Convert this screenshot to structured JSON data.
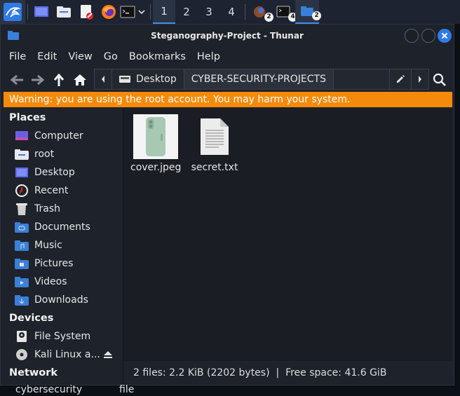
{
  "taskbar": {
    "workspaces": [
      "1",
      "2",
      "3",
      "4"
    ],
    "badges": {
      "app1": "2",
      "terminal": "4",
      "files": "2"
    }
  },
  "window": {
    "title": "Steganography-Project - Thunar",
    "menus": [
      "File",
      "Edit",
      "View",
      "Go",
      "Bookmarks",
      "Help"
    ],
    "breadcrumbs": [
      "Desktop",
      "CYBER-SECURITY-PROJECTS"
    ],
    "warning": "Warning: you are using the root account. You may harm your system."
  },
  "sidebar": {
    "places_heading": "Places",
    "places": [
      "Computer",
      "root",
      "Desktop",
      "Recent",
      "Trash",
      "Documents",
      "Music",
      "Pictures",
      "Videos",
      "Downloads"
    ],
    "devices_heading": "Devices",
    "devices": [
      "File System",
      "Kali Linux a..."
    ],
    "network_heading": "Network"
  },
  "files": [
    {
      "name": "cover.jpeg",
      "icon": "image-thumbnail"
    },
    {
      "name": "secret.txt",
      "icon": "text-file-icon"
    }
  ],
  "status": "2 files: 2.2 KiB (2202 bytes)  |  Free space: 41.6 GiB",
  "desktop_behind": [
    "cybersecurity",
    "file"
  ],
  "colors": {
    "accent": "#3e8ee8",
    "warning": "#f58a0a",
    "folder": "#3a7fd8"
  }
}
